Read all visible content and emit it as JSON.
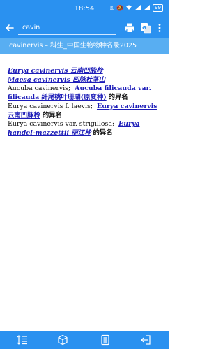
{
  "status": {
    "time": "18:54",
    "battery": "99"
  },
  "search": {
    "value": "cavin"
  },
  "page": {
    "title": "cavinervis – 科生_中国生物物种名录2025"
  },
  "entries": [
    {
      "link": "Eurya cavinervis 云南凹脉柃"
    },
    {
      "link": "Maesa cavinervis 凹脉杜茎山"
    },
    {
      "prefix": "Aucuba cavinervis;",
      "link": "Aucuba filicauda var. filicauda 纤尾桃叶珊瑚(原变种)",
      "suffix": "的异名"
    },
    {
      "prefix": "Eurya cavinervis f. laevis;",
      "link": "Eurya cavinervis 云南凹脉柃",
      "suffix": "的异名"
    },
    {
      "prefix": "Eurya cavinervis var. strigillosa;",
      "link": "Eurya handel-mazzettii 丽江柃",
      "suffix": "的异名"
    }
  ],
  "colors": {
    "bar": "#2a91f0",
    "title_bar": "#58aef2",
    "link": "#1c1cb8"
  },
  "icons": [
    "back-arrow-icon",
    "print-icon",
    "translate-icon",
    "more-vert-icon",
    "line-spacing-icon",
    "cube-icon",
    "document-icon",
    "exit-icon"
  ]
}
